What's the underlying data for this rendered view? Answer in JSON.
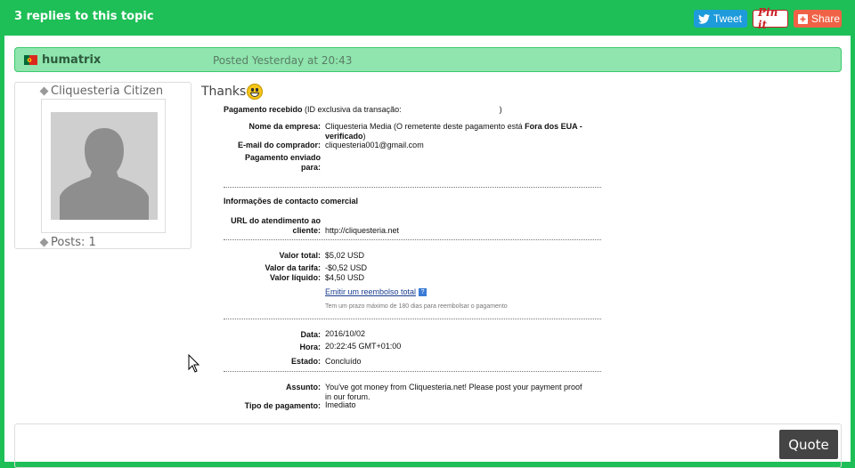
{
  "topic": {
    "replies_title": "3 replies to this topic"
  },
  "share": {
    "tweet": "Tweet",
    "pin": "Pin it",
    "share": "Share"
  },
  "post": {
    "author": "humatrix",
    "posted": "Posted Yesterday at 20:43",
    "user_rank": "Cliquesteria Citizen",
    "posts_count": "Posts: 1",
    "message": "Thanks",
    "receipt": {
      "heading": "Pagamento recebido",
      "heading_note": "(ID exclusiva da transação:",
      "heading_close": ")",
      "company_label": "Nome da empresa:",
      "company_line1_a": "Cliquesteria Media (O remetente deste pagamento está ",
      "company_line1_b": "Fora dos EUA -",
      "company_line2": "verificado",
      "company_line2_end": ")",
      "email_label": "E-mail do comprador:",
      "email_value": "cliquesteria001@gmail.com",
      "sent_to_label_1": "Pagamento enviado",
      "sent_to_label_2": "para:",
      "contact_heading": "Informações de contacto comercial",
      "url_label_1": "URL do atendimento ao",
      "url_label_2": "cliente:",
      "url_value": "http://cliquesteria.net",
      "total_label": "Valor total:",
      "total_value": "$5,02 USD",
      "fee_label": "Valor da tarifa:",
      "fee_value": "-$0,52 USD",
      "net_label": "Valor líquido:",
      "net_value": "$4,50 USD",
      "refund_link": "Emitir um reembolso total",
      "help_glyph": "?",
      "refund_note": "Tem um prazo máximo de 180 dias para reembolsar o pagamento",
      "date_label": "Data:",
      "date_value": "2016/10/02",
      "time_label": "Hora:",
      "time_value": "20:22:45 GMT+01:00",
      "state_label": "Estado:",
      "state_value": "Concluído",
      "subject_label": "Assunto:",
      "subject_line1": "You've got money from Cliquesteria.net! Please post your payment proof",
      "subject_line2": "in our forum.",
      "paytype_label": "Tipo de pagamento:",
      "paytype_value": "Imediato"
    }
  },
  "actions": {
    "quote": "Quote"
  },
  "colors": {
    "accent": "#1ebf57",
    "author_bar": "#8fe5ad",
    "tweet": "#1d9bdb",
    "pin": "#cb2027",
    "share": "#f06246",
    "quote_button": "#444444"
  }
}
